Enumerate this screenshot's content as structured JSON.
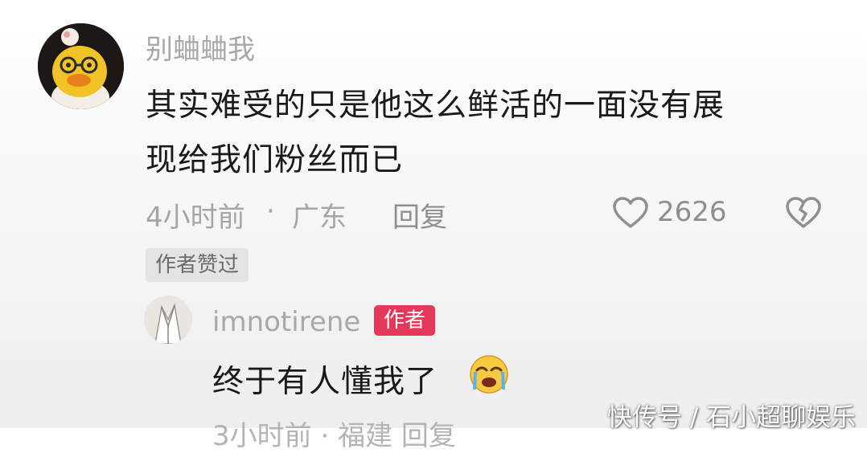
{
  "comment": {
    "username": "别蛐蛐我",
    "text_line1": "其实难受的只是他这么鲜活的一面没有展",
    "text_line2": "现给我们粉丝而已",
    "time": "4小时前",
    "separator": "·",
    "location": "广东",
    "reply_label": "回复",
    "like_count": "2626",
    "author_liked_tag": "作者赞过",
    "avatar_icon": "yellow-duck-plush-avatar"
  },
  "reply": {
    "username": "imnotirene",
    "author_badge": "作者",
    "text": "终于有人懂我了",
    "emoji_icon": "crying-face-icon",
    "next_meta_partial": "3小时前 · 福建   回复"
  },
  "watermark": "快传号 / 石小超聊娱乐",
  "colors": {
    "author_badge": "#e6385a",
    "meta_text": "#a5a5a5",
    "body_text": "#1a1a1a"
  }
}
